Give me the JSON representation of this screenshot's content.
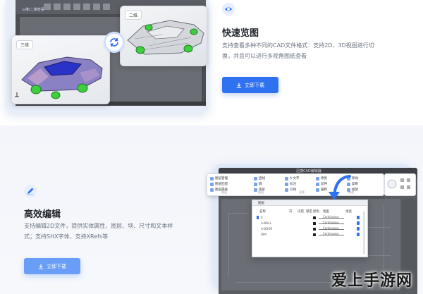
{
  "hero": {
    "title_stub": "三维/二维查看",
    "tag_3d": "三维",
    "tag_2d": "二维"
  },
  "features": [
    {
      "icon": "eye-icon",
      "title": "快速览图",
      "desc_line1": "支持查看多种不同的CAD文件格式：支持2D、3D视图进行切",
      "desc_line2": "换，并且可以进行多视角图纸查看",
      "cta": "立即下载"
    },
    {
      "icon": "edit-icon",
      "title": "高效编辑",
      "desc_line1": "支持编辑2D文件，提供实体属性、图层、块、尺寸和文本样",
      "desc_line2": "式；支持SHX字体、支持XRefs等",
      "cta": "立即下载"
    }
  ],
  "cad": {
    "window_title": "迅捷CAD编辑器",
    "dialog_title": "图层",
    "ribbon": {
      "r1": [
        "图层管理",
        "直线",
        "A 文字",
        "修剪",
        "移动"
      ],
      "r2": [
        "图层匹配",
        "圆",
        "标注",
        "延伸",
        "复制"
      ],
      "r3": [
        "图层隔离",
        "矩形",
        "引线",
        "偏移",
        "缩放"
      ],
      "groups": [
        "图层",
        "绘图",
        "注释",
        "修改"
      ]
    },
    "dialog_headers": [
      "名称",
      "开",
      "冻结",
      "锁定",
      "颜色",
      "线型",
      "线宽"
    ],
    "dialog_rows": [
      [
        "0",
        "",
        "Continuous"
      ],
      [
        "A-WALL",
        "",
        "Continuous"
      ],
      [
        "A-DOOR",
        "",
        "Continuous"
      ],
      [
        "DIM",
        "",
        "Continuous"
      ]
    ]
  },
  "watermark": "爱上手游网",
  "colors": {
    "primary": "#2f72f0",
    "primary_light": "#6a9df7",
    "title": "#1f2329",
    "desc": "#6b7480"
  }
}
